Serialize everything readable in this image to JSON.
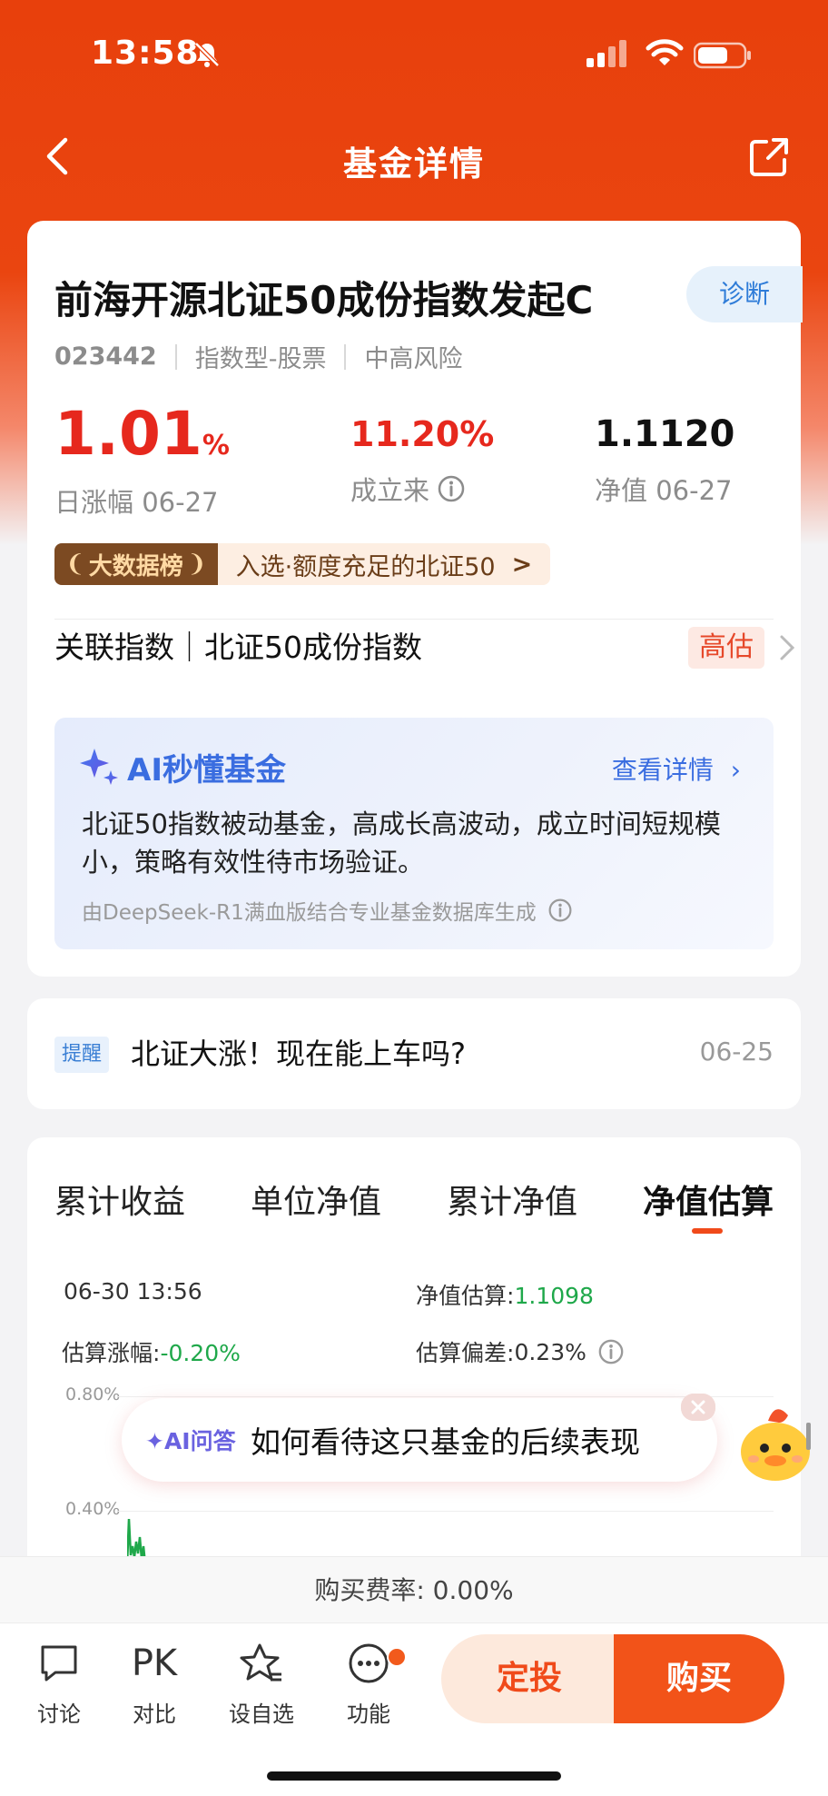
{
  "status_bar": {
    "time": "13:58"
  },
  "nav": {
    "title": "基金详情"
  },
  "fund": {
    "name": "前海开源北证50成份指数发起C",
    "diagnose_label": "诊断",
    "code": "023442",
    "type": "指数型-股票",
    "risk": "中高风险",
    "daily_change_value": "1.01",
    "daily_change_unit": "%",
    "daily_change_label": "日涨幅 06-27",
    "since_inception_value": "11.20%",
    "since_inception_label": "成立来",
    "nav_value": "1.1120",
    "nav_label": "净值 06-27",
    "rank_badge": "大数据榜",
    "rank_text": "入选·额度充足的北证50",
    "related_index": "关联指数｜北证50成份指数",
    "valuation_tag": "高估"
  },
  "ai_summary": {
    "title": "AI秒懂基金",
    "view_details": "查看详情",
    "description": "北证50指数被动基金，高成长高波动，成立时间短规模小，策略有效性待市场验证。",
    "note": "由DeepSeek-R1满血版结合专业基金数据库生成"
  },
  "reminder": {
    "tag": "提醒",
    "text": "北证大涨！现在能上车吗?",
    "date": "06-25"
  },
  "chart": {
    "tabs": [
      "累计收益",
      "单位净值",
      "累计净值",
      "净值估算"
    ],
    "active_tab": 3,
    "timestamp": "06-30 13:56",
    "est_nav_label": "净值估算:",
    "est_nav_value": "1.1098",
    "est_change_label": "估算涨幅:",
    "est_change_value": "-0.20%",
    "est_dev_label": "估算偏差:",
    "est_dev_value": "0.23%",
    "y_ticks": [
      "0.80%",
      "0.40%"
    ],
    "colors": {
      "up": "#e6281d",
      "down": "#1fa84a"
    }
  },
  "ask_banner": {
    "tag": "AI问答",
    "question": "如何看待这只基金的后续表现"
  },
  "fee": {
    "text": "购买费率: 0.00%"
  },
  "bottom_bar": {
    "discuss": "讨论",
    "pk_glyph": "PK",
    "compare": "对比",
    "watchlist": "设自选",
    "functions": "功能",
    "sip": "定投",
    "buy": "购买"
  },
  "colors": {
    "brand": "#e8400c",
    "accent": "#f25319",
    "ai_blue": "#3a6de0"
  }
}
